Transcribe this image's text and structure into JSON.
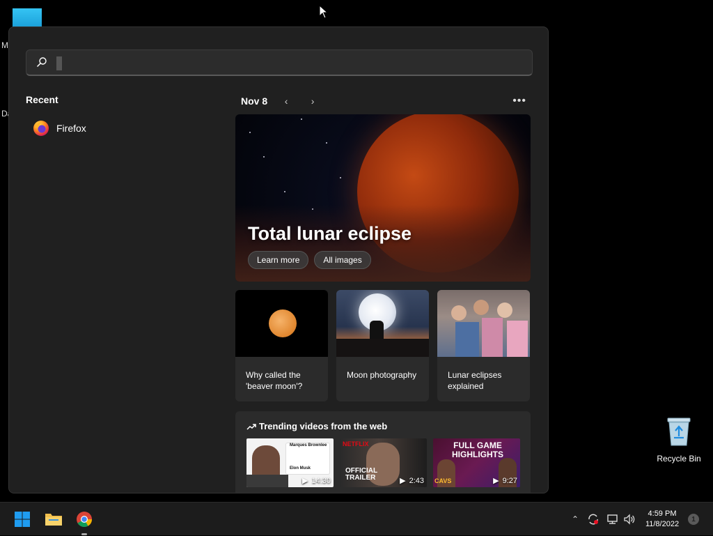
{
  "desktop": {
    "stub_text_1": "M",
    "stub_text_2": "Da",
    "recycle_bin_label": "Recycle Bin"
  },
  "search": {
    "placeholder": "",
    "value": ""
  },
  "recent": {
    "header": "Recent",
    "items": [
      {
        "label": "Firefox",
        "icon": "firefox-icon"
      }
    ]
  },
  "highlights": {
    "date": "Nov 8",
    "hero": {
      "title": "Total lunar eclipse",
      "buttons": [
        "Learn more",
        "All images"
      ]
    },
    "cards": [
      {
        "caption": "Why called the 'beaver moon'?"
      },
      {
        "caption": "Moon photography"
      },
      {
        "caption": "Lunar eclipses explained"
      }
    ],
    "trending": {
      "header": "Trending videos from the web",
      "videos": [
        {
          "duration": "14:30",
          "text_top": "Marques Brownlee",
          "text_line2": "Elon Musk"
        },
        {
          "duration": "2:43",
          "brand": "NETFLIX",
          "overlay": "OFFICIAL TRAILER"
        },
        {
          "duration": "9:27",
          "overlay": "FULL GAME HIGHLIGHTS",
          "team": "CAVS"
        }
      ]
    }
  },
  "taskbar": {
    "time": "4:59 PM",
    "date": "11/8/2022",
    "notification_count": "1"
  },
  "colors": {
    "panel_bg": "#202020",
    "card_bg": "#2b2b2b",
    "taskbar_bg": "#1c1c1c",
    "accent_blue": "#0078d4"
  }
}
